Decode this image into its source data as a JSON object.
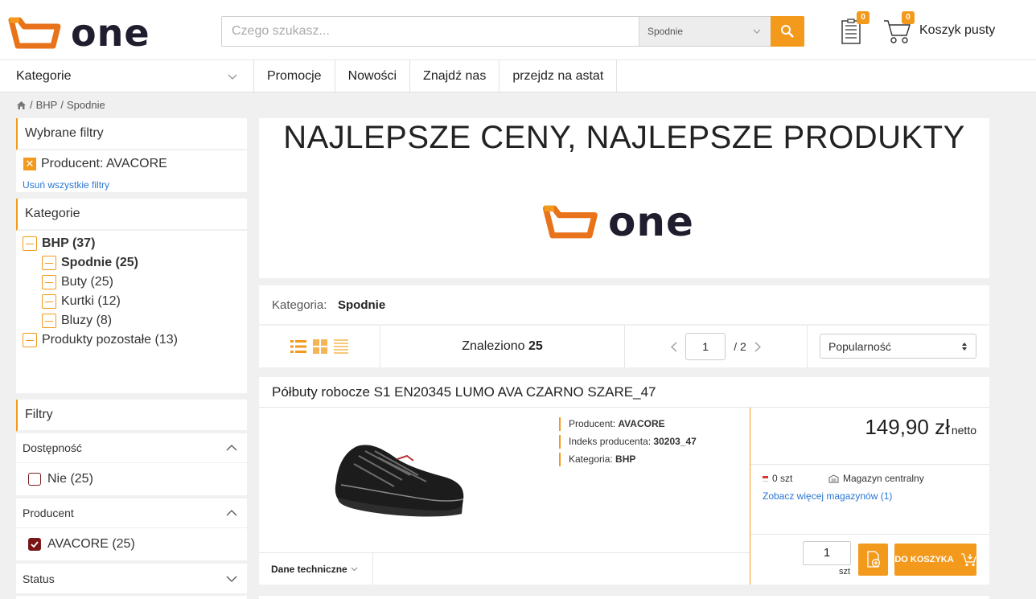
{
  "header": {
    "logo_text": "one",
    "search": {
      "placeholder": "Czego szukasz...",
      "category": "Spodnie"
    },
    "notes_badge": "0",
    "cart_badge": "0",
    "cart_label": "Koszyk pusty"
  },
  "nav": {
    "categories_label": "Kategorie",
    "items": [
      "Promocje",
      "Nowości",
      "Znajdź nas",
      "przejdz na astat"
    ]
  },
  "breadcrumb": {
    "items": [
      "BHP",
      "Spodnie"
    ],
    "separator": "/"
  },
  "sidebar": {
    "selected_filters": {
      "title": "Wybrane filtry",
      "chip": "Producent: AVACORE",
      "clear_all": "Usuń wszystkie filtry"
    },
    "categories": {
      "title": "Kategorie",
      "items": [
        {
          "label": "BHP (37)"
        },
        {
          "label": "Spodnie (25)"
        },
        {
          "label": "Buty (25)"
        },
        {
          "label": "Kurtki (12)"
        },
        {
          "label": "Bluzy (8)"
        },
        {
          "label": "Produkty pozostałe (13)"
        }
      ]
    },
    "filters": {
      "title": "Filtry",
      "availability": {
        "title": "Dostępność",
        "option": "Nie (25)",
        "checked": false
      },
      "producer": {
        "title": "Producent",
        "option": "AVACORE (25)",
        "checked": true
      },
      "status": {
        "title": "Status"
      }
    }
  },
  "banner": {
    "title": "NAJLEPSZE CENY, NAJLEPSZE PRODUKTY",
    "logo_text": "one"
  },
  "category_bar": {
    "label": "Kategoria:",
    "value": "Spodnie"
  },
  "toolbar": {
    "found_label": "Znaleziono",
    "found_count": "25",
    "page": "1",
    "total_pages": "/ 2",
    "sort": "Popularność"
  },
  "product": {
    "title": "Półbuty robocze S1 EN20345 LUMO AVA CZARNO SZARE_47",
    "meta": {
      "producer_label": "Producent:",
      "producer": "AVACORE",
      "index_label": "Indeks producenta:",
      "index": "30203_47",
      "category_label": "Kategoria:",
      "category": "BHP"
    },
    "price": "149,90 zł",
    "price_suffix": "netto",
    "stock": "0 szt",
    "warehouse": "Magazyn centralny",
    "more_warehouses": "Zobacz więcej magazynów (1)",
    "quantity": "1",
    "unit": "szt",
    "add_to_cart": "DO KOSZYKA",
    "tech_tab": "Dane techniczne"
  },
  "colors": {
    "accent": "#f39a1d",
    "logo_dark": "#1f1d2e",
    "link": "#2a76d2",
    "checkbox": "#7a1515"
  }
}
